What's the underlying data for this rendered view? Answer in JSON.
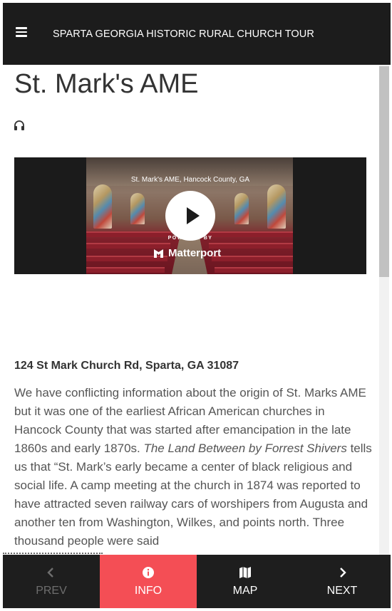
{
  "app": {
    "title": "SPARTA GEORGIA HISTORIC RURAL CHURCH TOUR",
    "menu_icon": "hamburger-icon"
  },
  "page": {
    "title": "St. Mark's AME",
    "audio_icon": "headphones-icon"
  },
  "video": {
    "caption": "St. Mark's AME, Hancock County, GA",
    "powered_by": "POWERED BY",
    "brand": "Matterport",
    "play_icon": "play-icon"
  },
  "content": {
    "address": "124 St Mark Church Rd, Sparta, GA 31087",
    "para_1": "We have conflicting information about the origin of St. Marks AME but it was one of the earliest African American churches in Hancock County that was started after emancipation in the late 1860s and early 1870s. ",
    "para_italic": "The Land Between by Forrest Shivers",
    "para_2": " tells us that “St. Mark’s early became a center of black religious and social life. A camp meeting at the church in 1874 was reported to have attracted seven railway cars of worshipers from Augusta and another ten from Washington, Wilkes, and points north.  Three thousand people were said"
  },
  "bottom_nav": {
    "prev_label": "PREV",
    "info_label": "INFO",
    "map_label": "MAP",
    "next_label": "NEXT",
    "active_color": "#f44e55",
    "disabled_color": "#6e6e6e"
  }
}
